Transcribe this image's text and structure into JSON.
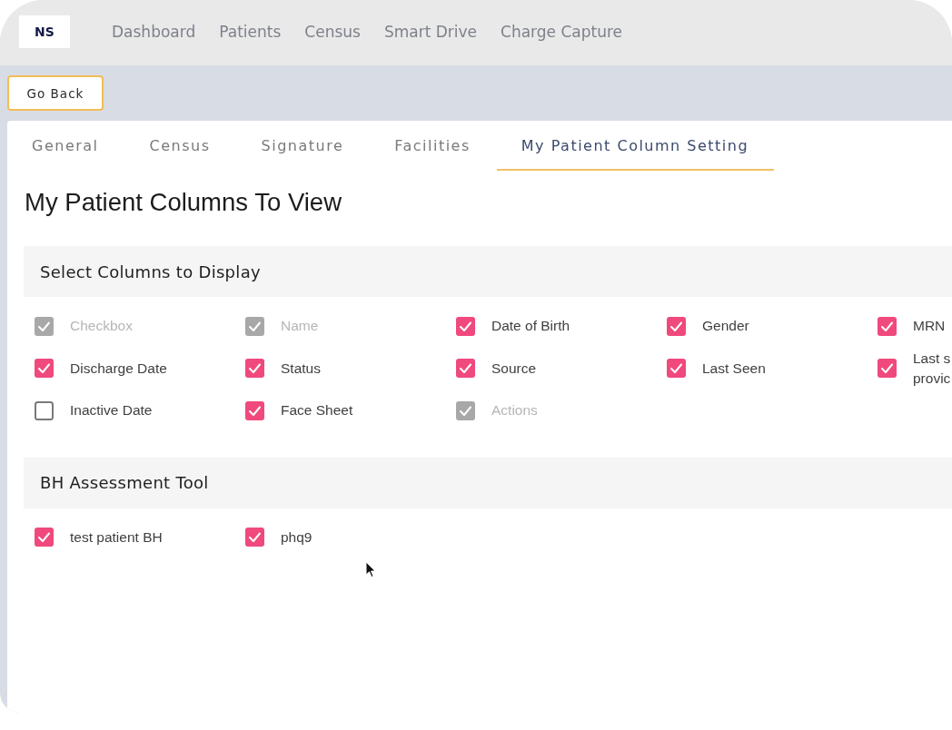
{
  "nav": {
    "logo": "NS",
    "links": [
      "Dashboard",
      "Patients",
      "Census",
      "Smart Drive",
      "Charge Capture"
    ]
  },
  "toolbar": {
    "back_button": "Go Back"
  },
  "tabs": [
    {
      "label": "General",
      "selected": false
    },
    {
      "label": "Census",
      "selected": false
    },
    {
      "label": "Signature",
      "selected": false
    },
    {
      "label": "Facilities",
      "selected": false
    },
    {
      "label": "My Patient Column Setting",
      "selected": true
    }
  ],
  "page_title": "My Patient Columns To View",
  "sections": [
    {
      "title": "Select Columns to Display",
      "items": [
        {
          "label": "Checkbox",
          "checked": true,
          "disabled": true
        },
        {
          "label": "Name",
          "checked": true,
          "disabled": true
        },
        {
          "label": "Date of Birth",
          "checked": true,
          "disabled": false
        },
        {
          "label": "Gender",
          "checked": true,
          "disabled": false
        },
        {
          "label": "MRN",
          "checked": true,
          "disabled": false
        },
        {
          "label": "Discharge Date",
          "checked": true,
          "disabled": false
        },
        {
          "label": "Status",
          "checked": true,
          "disabled": false
        },
        {
          "label": "Source",
          "checked": true,
          "disabled": false
        },
        {
          "label": "Last Seen",
          "checked": true,
          "disabled": false
        },
        {
          "label": "Last s\nprovic",
          "checked": true,
          "disabled": false
        },
        {
          "label": "Inactive Date",
          "checked": false,
          "disabled": false
        },
        {
          "label": "Face Sheet",
          "checked": true,
          "disabled": false
        },
        {
          "label": "Actions",
          "checked": true,
          "disabled": true
        }
      ]
    },
    {
      "title": "BH Assessment Tool",
      "items": [
        {
          "label": "test patient BH",
          "checked": true,
          "disabled": false
        },
        {
          "label": "phq9",
          "checked": true,
          "disabled": false
        }
      ]
    }
  ]
}
